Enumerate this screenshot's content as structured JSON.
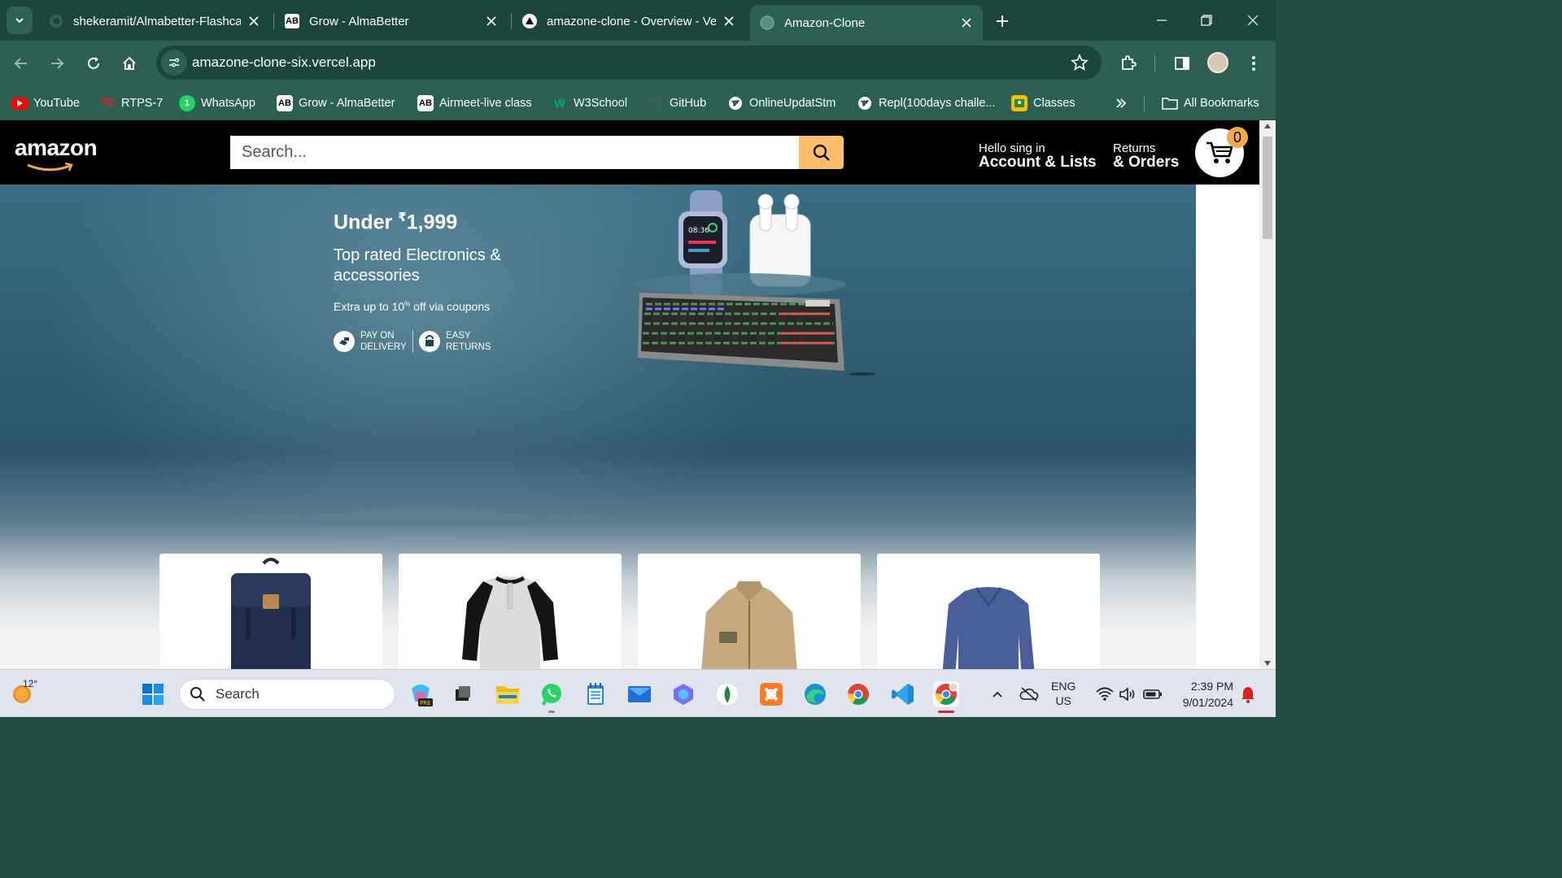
{
  "browser": {
    "tabs": [
      {
        "title": "shekeramit/Almabetter-Flashcard",
        "icon": "github-icon"
      },
      {
        "title": "Grow - AlmaBetter",
        "icon": "almabetter-icon"
      },
      {
        "title": "amazone-clone - Overview - Vercel",
        "icon": "vercel-icon"
      },
      {
        "title": "Amazon-Clone",
        "icon": "globe-icon",
        "active": true
      }
    ],
    "url": "amazone-clone-six.vercel.app",
    "bookmarks": [
      {
        "label": "YouTube",
        "icon": "youtube-icon"
      },
      {
        "label": "RTPS-7",
        "icon": "rtps-icon"
      },
      {
        "label": "WhatsApp",
        "icon": "whatsapp-icon"
      },
      {
        "label": "Grow - AlmaBetter",
        "icon": "almabetter-icon"
      },
      {
        "label": "Airmeet-live class",
        "icon": "almabetter-icon"
      },
      {
        "label": "W3School",
        "icon": "w3school-icon"
      },
      {
        "label": "GitHub",
        "icon": "github-icon"
      },
      {
        "label": "OnlineUpdatStm",
        "icon": "globe-icon"
      },
      {
        "label": "Repl(100days challe...",
        "icon": "globe-icon"
      },
      {
        "label": "Classes",
        "icon": "classroom-icon"
      }
    ],
    "all_bookmarks": "All Bookmarks",
    "colors": {
      "frame": "#1c463d",
      "toolbar": "#2d6053"
    }
  },
  "amazon": {
    "logo": "amazon",
    "search_placeholder": "Search...",
    "account_line1": "Hello sing in",
    "account_line2": "Account & Lists",
    "returns_line1": "Returns",
    "returns_line2": "& Orders",
    "cart_count": "0",
    "colors": {
      "header": "#000000",
      "search_button": "#febd69",
      "cart_badge": "#f3a847"
    }
  },
  "hero": {
    "title_prefix": "Under ",
    "currency": "₹",
    "price": "1,999",
    "subtitle": "Top rated Electronics & accessories",
    "coupon_prefix": "Extra up to 10",
    "coupon_sup": "%",
    "coupon_suffix": " off via coupons",
    "badge1_line1": "PAY ON",
    "badge1_line2": "DELIVERY",
    "badge2_line1": "EASY",
    "badge2_line2": "RETURNS"
  },
  "products": [
    {
      "name": "backpack-image"
    },
    {
      "name": "raglan-tshirt-image"
    },
    {
      "name": "jacket-image"
    },
    {
      "name": "sweater-image"
    }
  ],
  "taskbar": {
    "weather_temp": "12°",
    "search_label": "Search",
    "lang1": "ENG",
    "lang2": "US",
    "time": "2:39 PM",
    "date": "9/01/2024"
  }
}
